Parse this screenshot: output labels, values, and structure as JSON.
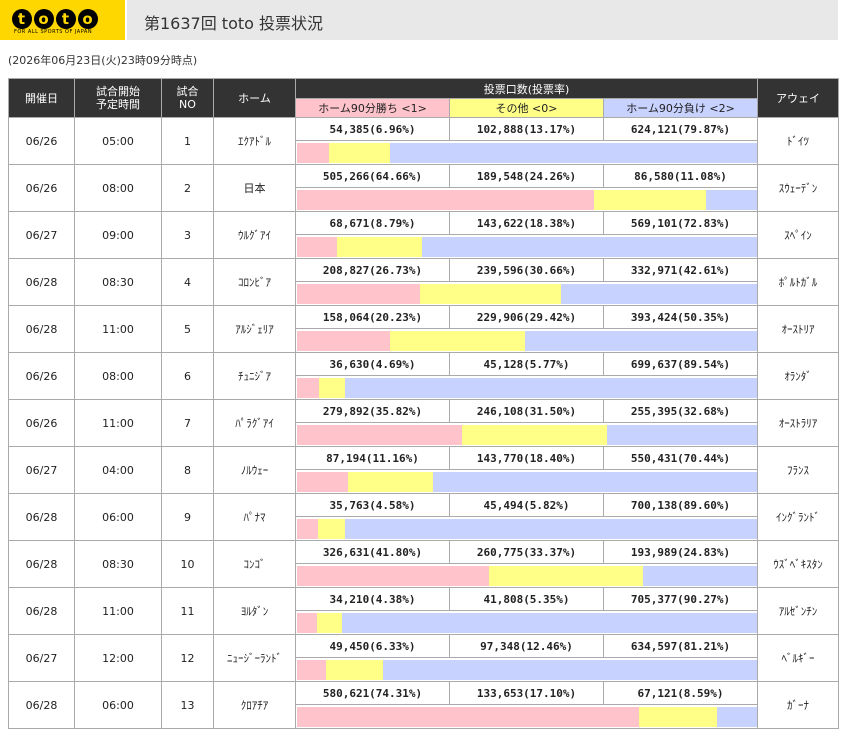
{
  "header": {
    "logo_text": "toto",
    "logo_sub": "FOR ALL SPORTS OF JAPAN",
    "title": "第1637回 toto 投票状況"
  },
  "updated": "(2026年06月23日(火)23時09分時点)",
  "columns": {
    "date": "開催日",
    "time": "試合開始予定時間",
    "no": "試合NO",
    "home": "ホーム",
    "votes": "投票口数(投票率)",
    "home_win": "ホーム90分勝ち <1>",
    "other": "その他 <0>",
    "home_lose": "ホーム90分負け <2>",
    "away": "アウェイ"
  },
  "colors": {
    "home_win": "#ffc4cb",
    "other": "#ffff88",
    "home_lose": "#c8d2ff",
    "header": "#333333",
    "logo": "#ffd700"
  },
  "matches": [
    {
      "date": "06/26",
      "time": "05:00",
      "no": "1",
      "home": "ｴｸｱﾄﾞﾙ",
      "v1": "54,385(6.96%)",
      "v0": "102,888(13.17%)",
      "v2": "624,121(79.87%)",
      "p1": 6.96,
      "p0": 13.17,
      "p2": 79.87,
      "away": "ﾄﾞｲﾂ"
    },
    {
      "date": "06/26",
      "time": "08:00",
      "no": "2",
      "home": "日本",
      "v1": "505,266(64.66%)",
      "v0": "189,548(24.26%)",
      "v2": "86,580(11.08%)",
      "p1": 64.66,
      "p0": 24.26,
      "p2": 11.08,
      "away": "ｽｳｪｰﾃﾞﾝ"
    },
    {
      "date": "06/27",
      "time": "09:00",
      "no": "3",
      "home": "ｳﾙｸﾞｱｲ",
      "v1": "68,671(8.79%)",
      "v0": "143,622(18.38%)",
      "v2": "569,101(72.83%)",
      "p1": 8.79,
      "p0": 18.38,
      "p2": 72.83,
      "away": "ｽﾍﾟｲﾝ"
    },
    {
      "date": "06/28",
      "time": "08:30",
      "no": "4",
      "home": "ｺﾛﾝﾋﾞｱ",
      "v1": "208,827(26.73%)",
      "v0": "239,596(30.66%)",
      "v2": "332,971(42.61%)",
      "p1": 26.73,
      "p0": 30.66,
      "p2": 42.61,
      "away": "ﾎﾟﾙﾄｶﾞﾙ"
    },
    {
      "date": "06/28",
      "time": "11:00",
      "no": "5",
      "home": "ｱﾙｼﾞｪﾘｱ",
      "v1": "158,064(20.23%)",
      "v0": "229,906(29.42%)",
      "v2": "393,424(50.35%)",
      "p1": 20.23,
      "p0": 29.42,
      "p2": 50.35,
      "away": "ｵｰｽﾄﾘｱ"
    },
    {
      "date": "06/26",
      "time": "08:00",
      "no": "6",
      "home": "ﾁｭﾆｼﾞｱ",
      "v1": "36,630(4.69%)",
      "v0": "45,128(5.77%)",
      "v2": "699,637(89.54%)",
      "p1": 4.69,
      "p0": 5.77,
      "p2": 89.54,
      "away": "ｵﾗﾝﾀﾞ"
    },
    {
      "date": "06/26",
      "time": "11:00",
      "no": "7",
      "home": "ﾊﾟﾗｸﾞｱｲ",
      "v1": "279,892(35.82%)",
      "v0": "246,108(31.50%)",
      "v2": "255,395(32.68%)",
      "p1": 35.82,
      "p0": 31.5,
      "p2": 32.68,
      "away": "ｵｰｽﾄﾗﾘｱ"
    },
    {
      "date": "06/27",
      "time": "04:00",
      "no": "8",
      "home": "ﾉﾙｳｪｰ",
      "v1": "87,194(11.16%)",
      "v0": "143,770(18.40%)",
      "v2": "550,431(70.44%)",
      "p1": 11.16,
      "p0": 18.4,
      "p2": 70.44,
      "away": "ﾌﾗﾝｽ"
    },
    {
      "date": "06/28",
      "time": "06:00",
      "no": "9",
      "home": "ﾊﾟﾅﾏ",
      "v1": "35,763(4.58%)",
      "v0": "45,494(5.82%)",
      "v2": "700,138(89.60%)",
      "p1": 4.58,
      "p0": 5.82,
      "p2": 89.6,
      "away": "ｲﾝｸﾞﾗﾝﾄﾞ"
    },
    {
      "date": "06/28",
      "time": "08:30",
      "no": "10",
      "home": "ｺﾝｺﾞ",
      "v1": "326,631(41.80%)",
      "v0": "260,775(33.37%)",
      "v2": "193,989(24.83%)",
      "p1": 41.8,
      "p0": 33.37,
      "p2": 24.83,
      "away": "ｳｽﾞﾍﾞｷｽﾀﾝ"
    },
    {
      "date": "06/28",
      "time": "11:00",
      "no": "11",
      "home": "ﾖﾙﾀﾞﾝ",
      "v1": "34,210(4.38%)",
      "v0": "41,808(5.35%)",
      "v2": "705,377(90.27%)",
      "p1": 4.38,
      "p0": 5.35,
      "p2": 90.27,
      "away": "ｱﾙｾﾞﾝﾁﾝ"
    },
    {
      "date": "06/27",
      "time": "12:00",
      "no": "12",
      "home": "ﾆｭｰｼﾞｰﾗﾝﾄﾞ",
      "v1": "49,450(6.33%)",
      "v0": "97,348(12.46%)",
      "v2": "634,597(81.21%)",
      "p1": 6.33,
      "p0": 12.46,
      "p2": 81.21,
      "away": "ﾍﾞﾙｷﾞｰ"
    },
    {
      "date": "06/28",
      "time": "06:00",
      "no": "13",
      "home": "ｸﾛｱﾁｱ",
      "v1": "580,621(74.31%)",
      "v0": "133,653(17.10%)",
      "v2": "67,121(8.59%)",
      "p1": 74.31,
      "p0": 17.1,
      "p2": 8.59,
      "away": "ｶﾞｰﾅ"
    }
  ]
}
